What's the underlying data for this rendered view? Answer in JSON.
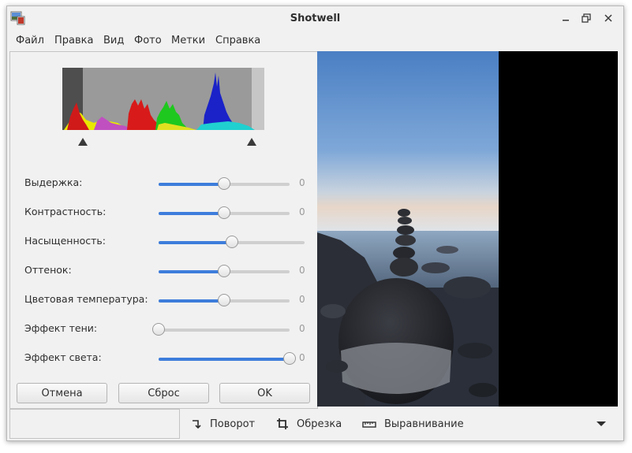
{
  "window": {
    "title": "Shotwell"
  },
  "menu": [
    "Файл",
    "Правка",
    "Вид",
    "Фото",
    "Метки",
    "Справка"
  ],
  "sliders": [
    {
      "label": "Выдержка:",
      "value": "0",
      "level": 0.5
    },
    {
      "label": "Контрастность:",
      "value": "0",
      "level": 0.5
    },
    {
      "label": "Насыщенность:",
      "value": "",
      "level": 0.5
    },
    {
      "label": "Оттенок:",
      "value": "0",
      "level": 0.5
    },
    {
      "label": "Цветовая температура:",
      "value": "0",
      "level": 0.5
    },
    {
      "label": "Эффект тени:",
      "value": "0",
      "level": 0.0
    },
    {
      "label": "Эффект света:",
      "value": "0",
      "level": 1.0
    }
  ],
  "buttons": {
    "cancel": "Отмена",
    "reset": "Сброс",
    "ok": "OK"
  },
  "toolbar": {
    "rotate": "Поворот",
    "crop": "Обрезка",
    "straighten": "Выравнивание"
  },
  "colors": {
    "accent": "#3d7ddb",
    "panel_bg": "#f1f1f1",
    "photo_bg": "#000000"
  }
}
